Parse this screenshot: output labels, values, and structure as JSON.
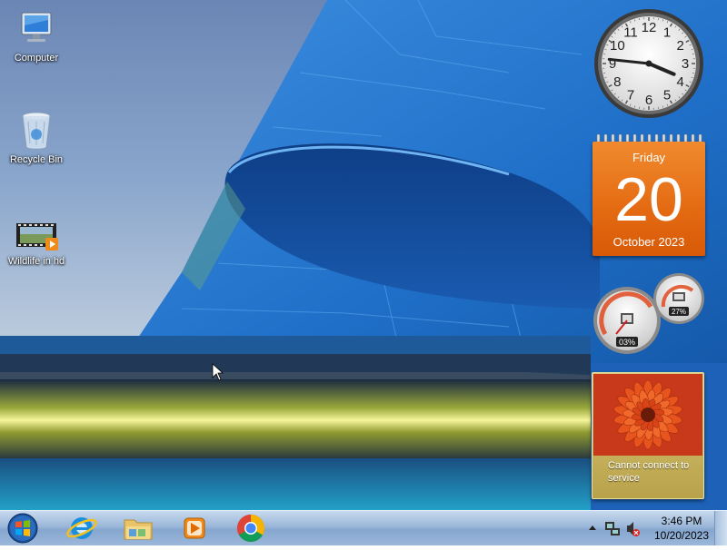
{
  "desktop_icons": [
    {
      "label": "Computer",
      "icon": "computer-icon"
    },
    {
      "label": "Recycle Bin",
      "icon": "recycle-bin-icon"
    },
    {
      "label": "Wildlife in hd",
      "icon": "video-file-icon"
    }
  ],
  "gadgets": {
    "clock": {
      "hour": 3,
      "minute": 46,
      "numerals": [
        "12",
        "1",
        "2",
        "3",
        "4",
        "5",
        "6",
        "7",
        "8",
        "9",
        "10",
        "11"
      ]
    },
    "calendar": {
      "day_name": "Friday",
      "date": "20",
      "month_year": "October 2023"
    },
    "cpu_meter": {
      "cpu_percent": "03%",
      "memory_percent": "27%"
    },
    "slideshow": {
      "message": "Cannot connect to service"
    }
  },
  "taskbar": {
    "pinned": [
      {
        "name": "Start",
        "icon": "windows-start-icon"
      },
      {
        "name": "Internet Explorer",
        "icon": "internet-explorer-icon"
      },
      {
        "name": "Windows Explorer",
        "icon": "folder-icon"
      },
      {
        "name": "Windows Media Player",
        "icon": "media-player-icon"
      },
      {
        "name": "Google Chrome",
        "icon": "chrome-icon"
      }
    ],
    "tray": {
      "time": "3:46 PM",
      "date": "10/20/2023"
    }
  },
  "colors": {
    "calendar_orange": "#e46a12",
    "taskbar": "#9ab6d8"
  }
}
